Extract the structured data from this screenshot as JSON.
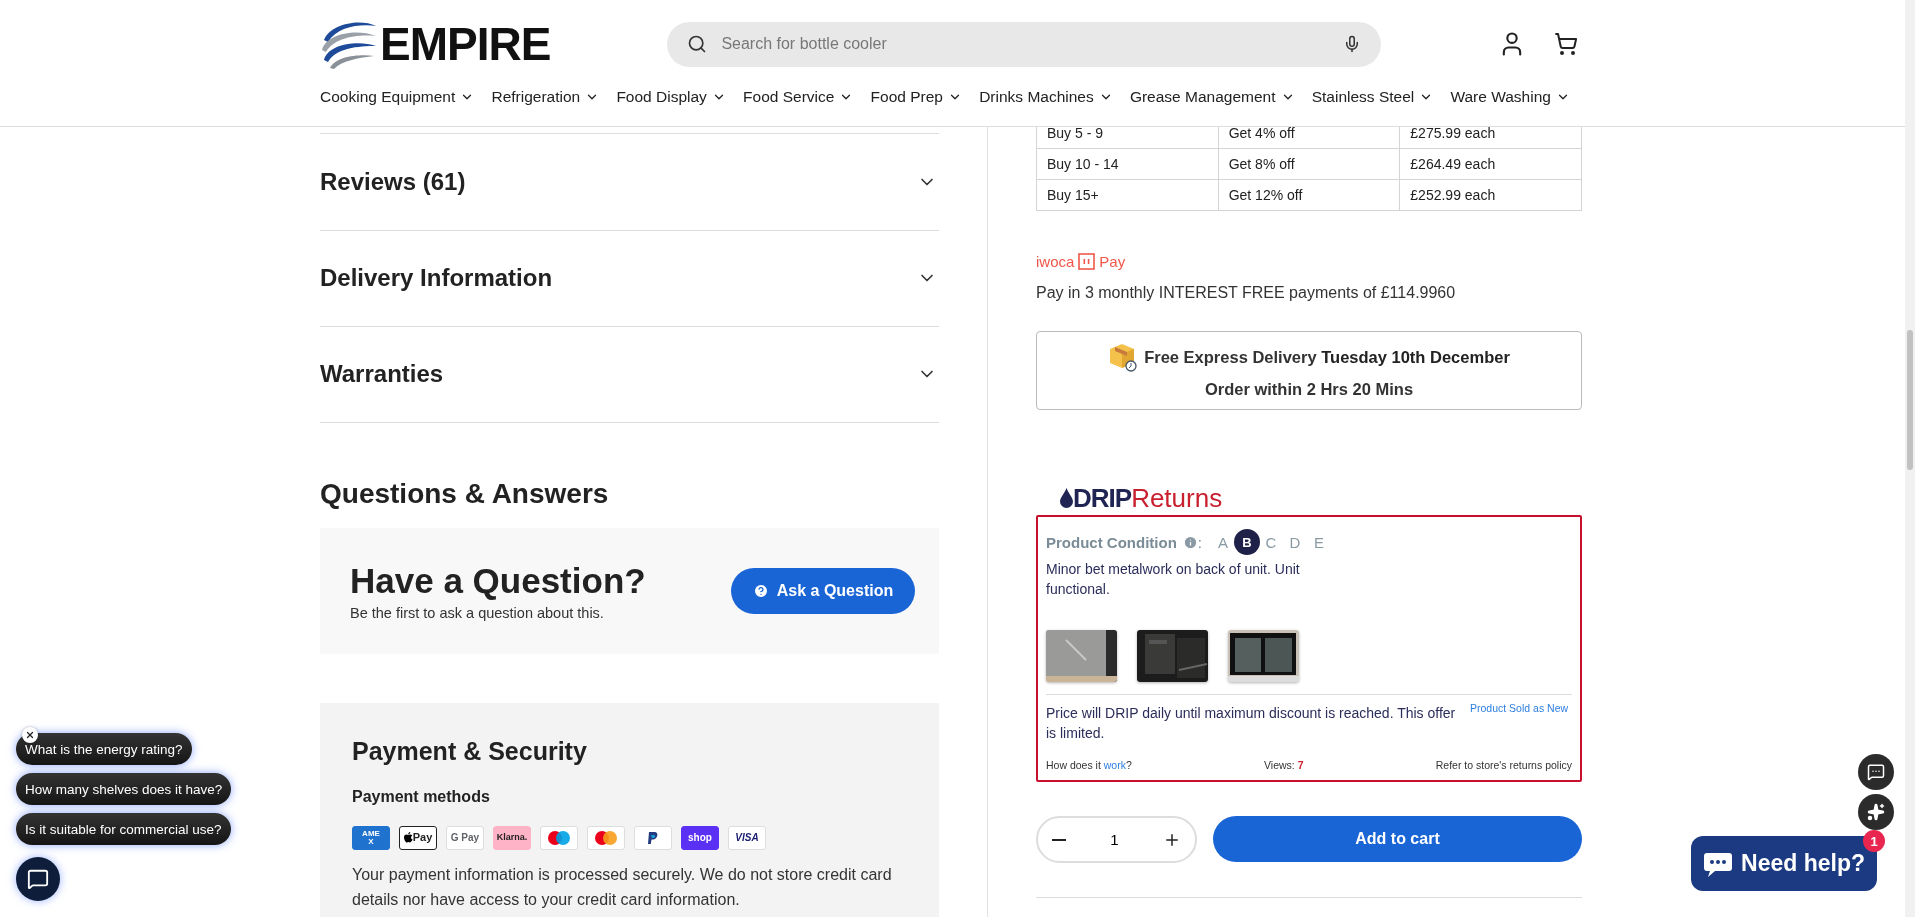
{
  "header": {
    "logo": "EMPIRE",
    "search": {
      "placeholder": "Search for bottle cooler"
    },
    "nav": [
      {
        "label": "Cooking Equipment"
      },
      {
        "label": "Refrigeration"
      },
      {
        "label": "Food Display"
      },
      {
        "label": "Food Service"
      },
      {
        "label": "Food Prep"
      },
      {
        "label": "Drinks Machines"
      },
      {
        "label": "Grease Management"
      },
      {
        "label": "Stainless Steel"
      },
      {
        "label": "Ware Washing"
      }
    ]
  },
  "accordion": [
    {
      "label": "Reviews (61)",
      "expanded": false
    },
    {
      "label": "Delivery Information",
      "expanded": false
    },
    {
      "label": "Warranties",
      "expanded": false
    }
  ],
  "qa": {
    "title": "Questions & Answers",
    "heading": "Have a Question?",
    "subtext": "Be the first to ask a question about this.",
    "button": "Ask a Question"
  },
  "payment": {
    "title": "Payment & Security",
    "methods_title": "Payment methods",
    "methods": [
      {
        "kind": "amex",
        "label": "AMEX"
      },
      {
        "kind": "apple",
        "label": "Pay"
      },
      {
        "kind": "google",
        "label": "G Pay"
      },
      {
        "kind": "klarna",
        "label": "Klarna."
      },
      {
        "kind": "maestro"
      },
      {
        "kind": "mastercard"
      },
      {
        "kind": "paypal"
      },
      {
        "kind": "shop",
        "label": "shop"
      },
      {
        "kind": "visa",
        "label": "VISA"
      }
    ],
    "note": "Your payment information is processed securely. We do not store credit card details nor have access to your credit card information."
  },
  "pricing_table": {
    "rows": [
      {
        "cells": [
          "Buy 5 - 9",
          "Get 4% off",
          "£275.99 each"
        ]
      },
      {
        "cells": [
          "Buy 10 - 14",
          "Get 8% off",
          "£264.49 each"
        ]
      },
      {
        "cells": [
          "Buy 15+",
          "Get 12% off",
          "£252.99 each"
        ]
      }
    ]
  },
  "iwoca": {
    "brand": "iwoca",
    "pay": "Pay",
    "text": "Pay in 3 monthly INTEREST FREE payments of £114.9960"
  },
  "delivery": {
    "line1": "Free Express Delivery **Tuesday 10th December**",
    "line2": "Order within 2 Hrs 20 Mins"
  },
  "drip": {
    "logo_bold": "DRIP",
    "logo_light": "Returns",
    "condition_label": "Product Condition",
    "separator": ":",
    "grades": [
      {
        "label": "A",
        "selected": false
      },
      {
        "label": "B",
        "selected": true
      },
      {
        "label": "C",
        "selected": false
      },
      {
        "label": "D",
        "selected": false
      },
      {
        "label": "E",
        "selected": false
      }
    ],
    "description": "Minor bet metalwork on back of unit. Unit functional.",
    "offer": "Price will DRIP daily until maximum discount is reached. This offer is limited.",
    "sold_as_new": "Product Sold as New",
    "how": {
      "prefix": "How does it ",
      "link": "work",
      "suffix": "?"
    },
    "views_label": "Views:",
    "views": "7",
    "policy": "Refer to store's returns policy"
  },
  "cart": {
    "quantity": "1",
    "button": "Add to cart"
  },
  "chat_suggestions": [
    {
      "text": "What is the energy rating?"
    },
    {
      "text": "How many shelves does it have?"
    },
    {
      "text": "Is it suitable for commercial use?"
    }
  ],
  "help": {
    "label": "Need help?",
    "badge": "1"
  }
}
